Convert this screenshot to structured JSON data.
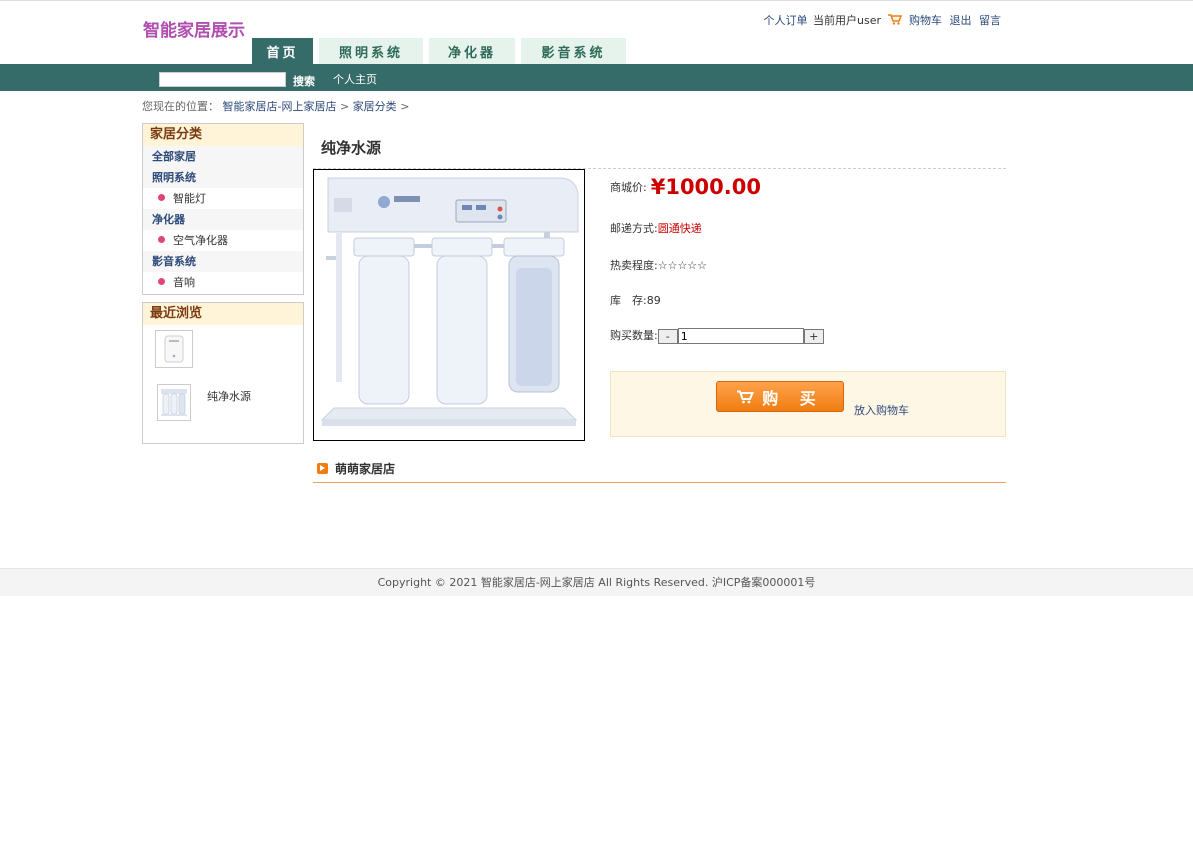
{
  "header": {
    "logo": "智能家居展示",
    "links": {
      "orders": "个人订单",
      "current_user_label": "当前用户",
      "username": "user",
      "cart": "购物车",
      "logout": "退出",
      "message": "留言"
    },
    "tabs": [
      {
        "label": "首页",
        "active": true
      },
      {
        "label": "照明系统",
        "active": false
      },
      {
        "label": "净化器",
        "active": false
      },
      {
        "label": "影音系统",
        "active": false
      }
    ]
  },
  "navbar": {
    "search_value": "",
    "search_label": "搜索",
    "home_label": "个人主页"
  },
  "breadcrumb": {
    "prefix": "您现在的位置：",
    "items": [
      "智能家居店-网上家居店",
      "家居分类"
    ],
    "sep": ">"
  },
  "sidebar": {
    "category_title": "家居分类",
    "rows": [
      {
        "type": "cat",
        "label": "全部家居"
      },
      {
        "type": "cat",
        "label": "照明系统"
      },
      {
        "type": "sub",
        "label": "智能灯"
      },
      {
        "type": "cat",
        "label": "净化器"
      },
      {
        "type": "sub",
        "label": "空气净化器"
      },
      {
        "type": "cat",
        "label": "影音系统"
      },
      {
        "type": "sub",
        "label": "音响"
      }
    ],
    "recent_title": "最近浏览",
    "recent": [
      {
        "name": ""
      },
      {
        "name": "纯净水源"
      }
    ]
  },
  "product": {
    "title": "纯净水源",
    "price_label": "商城价:",
    "price": "¥1000.00",
    "shipping_label": "邮递方式:",
    "shipping": "圆通快递",
    "hot_label": "热卖程度:",
    "hot_stars": "☆☆☆☆☆",
    "stock_label": "库　存:",
    "stock": "89",
    "qty_label": "购买数量:",
    "qty_value": "1",
    "qty_minus": "-",
    "qty_plus": "+",
    "buy_label": "购 买",
    "add_cart_label": "放入购物车"
  },
  "store": {
    "name": "萌萌家居店"
  },
  "footer": {
    "text": "Copyright © 2021 智能家居店-网上家居店 All Rights Reserved. 沪ICP备案000001号"
  },
  "colors": {
    "nav": "#356b68",
    "tab_inactive": "#e6f3ec",
    "logo": "#b04fb0",
    "price": "#cc0000",
    "accent_orange": "#f07d12"
  }
}
